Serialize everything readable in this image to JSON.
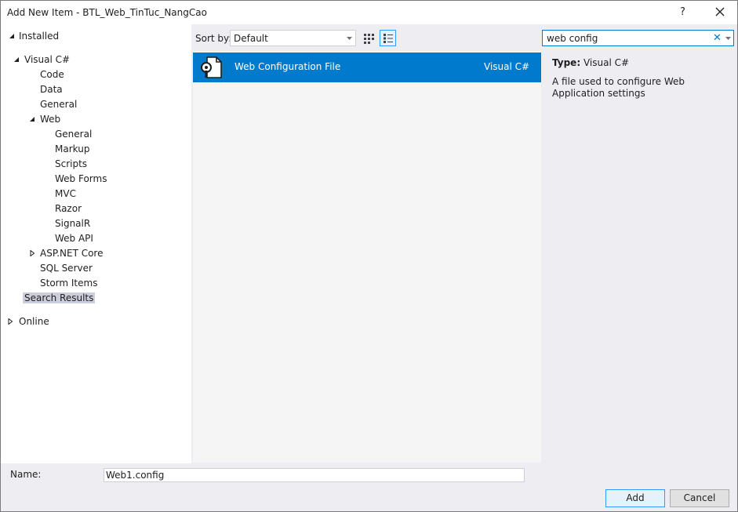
{
  "window": {
    "title": "Add New Item - BTL_Web_TinTuc_NangCao",
    "help_label": "?",
    "close_icon": "close-icon"
  },
  "tree": {
    "installed": "Installed",
    "visual_csharp": "Visual C#",
    "code": "Code",
    "data": "Data",
    "general": "General",
    "web": "Web",
    "web_general": "General",
    "markup": "Markup",
    "scripts": "Scripts",
    "web_forms": "Web Forms",
    "mvc": "MVC",
    "razor": "Razor",
    "signalr": "SignalR",
    "web_api": "Web API",
    "aspnet_core": "ASP.NET Core",
    "sql_server": "SQL Server",
    "storm_items": "Storm Items",
    "search_results": "Search Results",
    "online": "Online",
    "selected": "Search Results"
  },
  "toolbar": {
    "sort_label": "Sort by:",
    "sort_value": "Default",
    "view_modes": [
      "small-icons-view-icon",
      "list-view-icon"
    ],
    "active_view": "list-view-icon"
  },
  "search": {
    "value": "web config",
    "clear_icon": "clear-icon"
  },
  "templates": {
    "items": [
      {
        "name": "Web Configuration File",
        "language": "Visual C#",
        "icon": "config-file-icon",
        "selected": true
      }
    ]
  },
  "details": {
    "type_label": "Type:",
    "type_value": "Visual C#",
    "description": "A file used to configure Web Application settings"
  },
  "footer": {
    "name_label": "Name:",
    "name_value": "Web1.config",
    "add_label": "Add",
    "cancel_label": "Cancel"
  },
  "colors": {
    "accent": "#007acc",
    "selection_inactive": "#cccedb",
    "dialog_bg": "#eeeef2",
    "list_bg": "#f5f5f5"
  }
}
